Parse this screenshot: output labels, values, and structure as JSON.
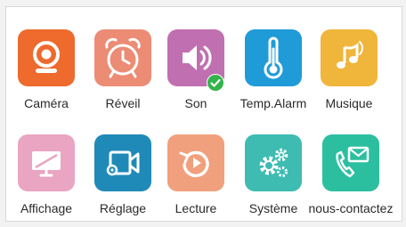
{
  "menu": {
    "items": [
      {
        "label": "Caméra",
        "icon": "camera-icon",
        "color": "#ee6a2d"
      },
      {
        "label": "Réveil",
        "icon": "alarm-clock-icon",
        "color": "#ec8c75"
      },
      {
        "label": "Son",
        "icon": "speaker-icon",
        "color": "#c06fb0",
        "badge": "check-icon"
      },
      {
        "label": "Temp.Alarm",
        "icon": "thermometer-icon",
        "color": "#1f9bd8"
      },
      {
        "label": "Musique",
        "icon": "music-note-icon",
        "color": "#f0b53b"
      },
      {
        "label": "Affichage",
        "icon": "monitor-icon",
        "color": "#e9a5c2"
      },
      {
        "label": "Réglage",
        "icon": "video-settings-icon",
        "color": "#1f8ab8"
      },
      {
        "label": "Lecture",
        "icon": "replay-icon",
        "color": "#f0a07c"
      },
      {
        "label": "Système",
        "icon": "gears-icon",
        "color": "#3ebcb2"
      },
      {
        "label": "nous-contactez",
        "icon": "phone-mail-icon",
        "color": "#2bbfa0"
      }
    ]
  }
}
